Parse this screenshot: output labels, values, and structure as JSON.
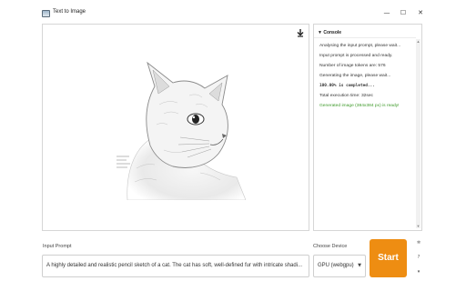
{
  "window": {
    "title": "Text to Image",
    "controls": {
      "minimize": "—",
      "maximize": "☐",
      "close": "✕"
    }
  },
  "image_panel": {
    "download_icon": "download-arrow-icon",
    "image_alt": "pencil sketch of a cat"
  },
  "console": {
    "header": "▼ Console",
    "lines": [
      {
        "text": "Analysing the input prompt, please wait...",
        "style": "normal"
      },
      {
        "text": "Input prompt is processed and ready.",
        "style": "normal"
      },
      {
        "text": "Number of image tokens are: 576",
        "style": "normal"
      },
      {
        "text": "Generating the image, please wait...",
        "style": "normal"
      },
      {
        "text": "100.00% is completed...",
        "style": "mono"
      },
      {
        "text": "Total execution time: 32sec",
        "style": "normal"
      },
      {
        "text": "Generated image (384x384 px) is ready!",
        "style": "success"
      }
    ]
  },
  "prompt": {
    "label": "Input Prompt",
    "value": "A highly detailed and realistic pencil sketch of a cat. The cat has soft, well-defined fur with intricate shadi..."
  },
  "device": {
    "label": "Choose Device",
    "selected": "GPU (webgpu)"
  },
  "start_button": {
    "label": "Start"
  },
  "side_icons": {
    "settings": "✲",
    "help": "?",
    "scroll": "▾"
  },
  "colors": {
    "accent": "#ee8d12",
    "success_text": "#3f9a2b",
    "border": "#d6d6d6"
  }
}
